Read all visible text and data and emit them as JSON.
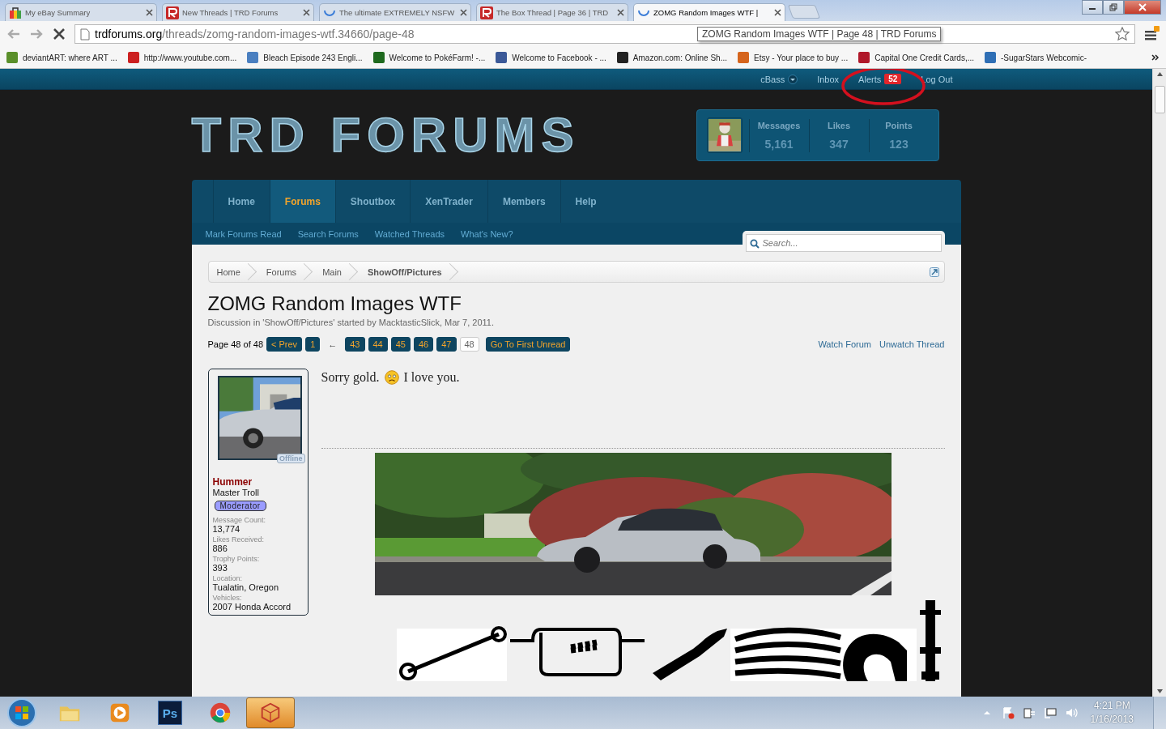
{
  "browser": {
    "tabs": [
      {
        "title": "My eBay Summary",
        "kind": "bag",
        "selected": false
      },
      {
        "title": "New Threads | TRD Forums",
        "kind": "r-logo",
        "selected": false
      },
      {
        "title": "The ultimate EXTREMELY NSFW",
        "kind": "spinner",
        "selected": false
      },
      {
        "title": "The Box Thread | Page 36 | TRD",
        "kind": "r-logo",
        "selected": false
      },
      {
        "title": "ZOMG Random Images WTF |",
        "kind": "spinner",
        "selected": true
      }
    ],
    "address": {
      "domain": "trdforums.org",
      "path": "/threads/zomg-random-images-wtf.34660/page-48"
    },
    "tooltip": "ZOMG Random Images WTF | Page 48 | TRD Forums",
    "bookmarks": [
      {
        "label": "deviantART: where ART ...",
        "color": "#5a8f2a"
      },
      {
        "label": "http://www.youtube.com...",
        "color": "#cc2020"
      },
      {
        "label": "Bleach Episode 243 Engli...",
        "color": "#4a7fc0"
      },
      {
        "label": "Welcome to PokéFarm! -...",
        "color": "#1f6a1f"
      },
      {
        "label": "Welcome to Facebook - ...",
        "color": "#3b5998"
      },
      {
        "label": "Amazon.com: Online Sh...",
        "color": "#222222"
      },
      {
        "label": "Etsy - Your place to buy ...",
        "color": "#d5641c"
      },
      {
        "label": "Capital One Credit Cards,...",
        "color": "#b0182a"
      },
      {
        "label": "-SugarStars Webcomic-",
        "color": "#2f6fb5"
      }
    ]
  },
  "userbar": [
    {
      "label": "cBass",
      "kind": "menu"
    },
    {
      "label": "Inbox",
      "kind": "link"
    },
    {
      "label": "Alerts",
      "kind": "alerts",
      "count": "52"
    },
    {
      "label": "Log Out",
      "kind": "link"
    }
  ],
  "logo": "TRD FORUMS",
  "stats": [
    {
      "label": "Messages",
      "value": "5,161"
    },
    {
      "label": "Likes",
      "value": "347"
    },
    {
      "label": "Points",
      "value": "123"
    }
  ],
  "nav": {
    "tabs": [
      {
        "label": "Home",
        "selected": false
      },
      {
        "label": "Forums",
        "selected": true
      },
      {
        "label": "Shoutbox",
        "selected": false
      },
      {
        "label": "XenTrader",
        "selected": false
      },
      {
        "label": "Members",
        "selected": false
      },
      {
        "label": "Help",
        "selected": false
      }
    ],
    "links": [
      "Mark Forums Read",
      "Search Forums",
      "Watched Threads",
      "What's New?"
    ],
    "search": {
      "placeholder": "Search..."
    }
  },
  "breadcrumb": [
    {
      "label": "Home",
      "selected": false
    },
    {
      "label": "Forums",
      "selected": false
    },
    {
      "label": "Main",
      "selected": false
    },
    {
      "label": "ShowOff/Pictures",
      "selected": true
    }
  ],
  "thread": {
    "title": "ZOMG Random Images WTF",
    "meta": "Discussion in 'ShowOff/Pictures' started by MacktasticSlick, Mar 7, 2011."
  },
  "pagination": {
    "summary": "Page 48 of 48",
    "prev": "< Prev",
    "first": "1",
    "gap": "←",
    "pages": [
      {
        "label": "43",
        "selected": false
      },
      {
        "label": "44",
        "selected": false
      },
      {
        "label": "45",
        "selected": false
      },
      {
        "label": "46",
        "selected": false
      },
      {
        "label": "47",
        "selected": false
      },
      {
        "label": "48",
        "selected": true
      }
    ],
    "unread": "Go To First Unread",
    "links": [
      "Watch Forum",
      "Unwatch Thread"
    ]
  },
  "post": {
    "author": {
      "status": "Offline",
      "name": "Hummer",
      "title": "Master Troll",
      "role": "Moderator",
      "info": [
        {
          "label": "Message Count:",
          "value": "13,774"
        },
        {
          "label": "Likes Received:",
          "value": "886"
        },
        {
          "label": "Trophy Points:",
          "value": "393"
        },
        {
          "label": "Location:",
          "value": "Tualatin, Oregon"
        },
        {
          "label": "Vehicles:",
          "value": "2007 Honda Accord"
        }
      ]
    },
    "message": {
      "before": "Sorry gold.",
      "after": "I love you."
    }
  },
  "taskbar": {
    "apps": [
      {
        "kind": "folder",
        "selected": false
      },
      {
        "kind": "media",
        "selected": false
      },
      {
        "kind": "photoshop",
        "label": "Ps",
        "selected": false
      },
      {
        "kind": "chrome",
        "selected": false
      },
      {
        "kind": "app",
        "selected": true
      }
    ],
    "time": "4:21 PM",
    "date": "1/16/2013"
  }
}
